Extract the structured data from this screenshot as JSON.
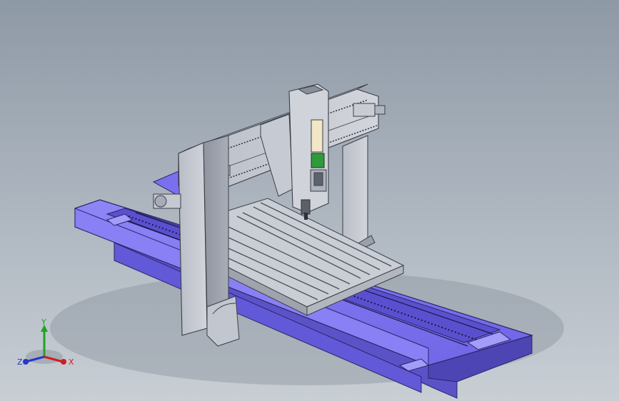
{
  "view": {
    "background_top": "#8e99a6",
    "background_bottom": "#c8ced4",
    "base_color": "#7b70f0",
    "steel_color": "#bcc0c9"
  },
  "triad": {
    "x_label": "X",
    "y_label": "Y",
    "z_label": "Z",
    "x_color": "#cc1f1f",
    "y_color": "#1fa41f",
    "z_color": "#2638c9"
  }
}
